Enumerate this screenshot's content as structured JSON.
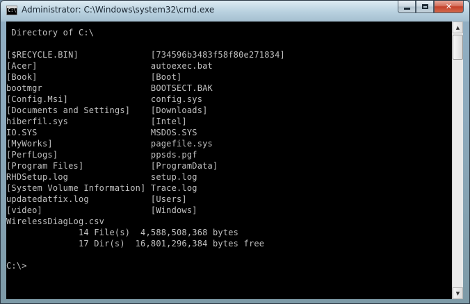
{
  "window": {
    "title": "Administrator: C:\\Windows\\system32\\cmd.exe",
    "icon_glyph": "C:\\"
  },
  "controls": {
    "minimize": "minimize-icon",
    "maximize": "maximize-icon",
    "close": "✕"
  },
  "console": {
    "lines": [
      " Directory of C:\\",
      "",
      "[$RECYCLE.BIN]              [734596b3483f58f80e271834]",
      "[Acer]                      autoexec.bat",
      "[Book]                      [Boot]",
      "bootmgr                     BOOTSECT.BAK",
      "[Config.Msi]                config.sys",
      "[Documents and Settings]    [Downloads]",
      "hiberfil.sys                [Intel]",
      "IO.SYS                      MSDOS.SYS",
      "[MyWorks]                   pagefile.sys",
      "[PerfLogs]                  ppsds.pgf",
      "[Program Files]             [ProgramData]",
      "RHDSetup.log                setup.log",
      "[System Volume Information] Trace.log",
      "updatedatfix.log            [Users]",
      "[video]                     [Windows]",
      "WirelessDiagLog.csv",
      "              14 File(s)  4,588,508,368 bytes",
      "              17 Dir(s)  16,801,296,384 bytes free",
      "",
      "C:\\>"
    ]
  },
  "scrollbar": {
    "up_arrow": "▲",
    "down_arrow": "▼"
  }
}
